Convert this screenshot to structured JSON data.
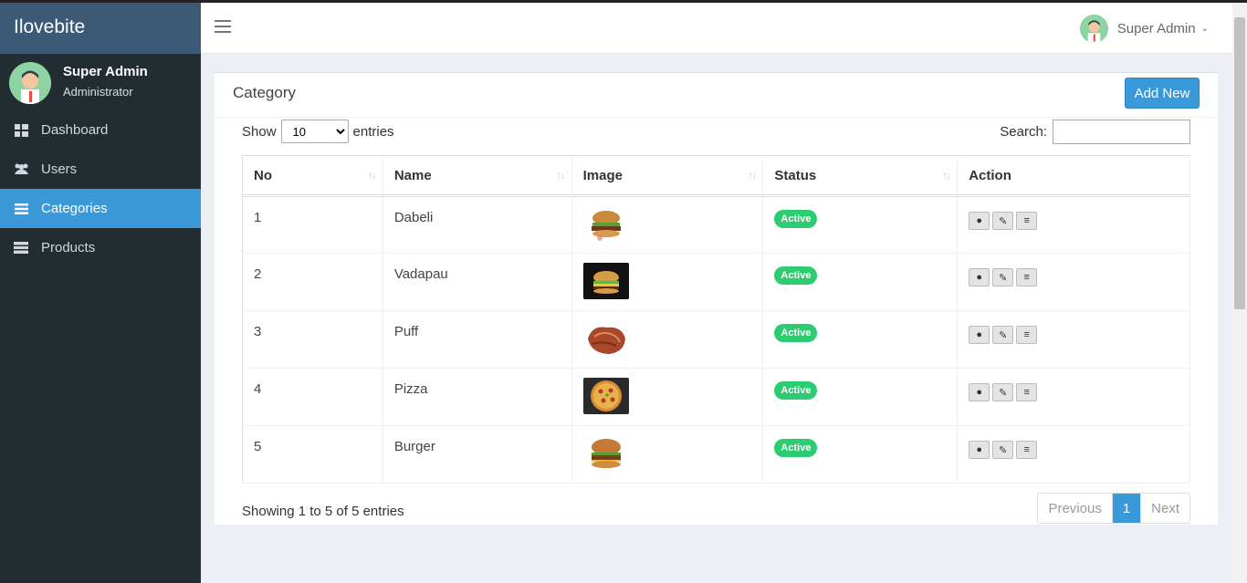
{
  "brand": "Ilovebite",
  "user": {
    "name": "Super Admin",
    "role": "Administrator"
  },
  "header_user": "Super Admin",
  "menu": [
    {
      "label": "Dashboard",
      "icon": "dashboard-icon"
    },
    {
      "label": "Users",
      "icon": "users-icon"
    },
    {
      "label": "Categories",
      "icon": "list-icon",
      "active": true
    },
    {
      "label": "Products",
      "icon": "products-icon"
    }
  ],
  "box": {
    "title": "Category",
    "add_label": "Add New"
  },
  "controls": {
    "show_label": "Show",
    "entries_label": "entries",
    "page_size": "10",
    "search_label": "Search:"
  },
  "table": {
    "headers": [
      "No",
      "Name",
      "Image",
      "Status",
      "Action"
    ],
    "rows": [
      {
        "no": "1",
        "name": "Dabeli",
        "status": "Active",
        "image": "burger-white-bg"
      },
      {
        "no": "2",
        "name": "Vadapau",
        "status": "Active",
        "image": "burger-dark-bg"
      },
      {
        "no": "3",
        "name": "Puff",
        "status": "Active",
        "image": "fried-food"
      },
      {
        "no": "4",
        "name": "Pizza",
        "status": "Active",
        "image": "pizza"
      },
      {
        "no": "5",
        "name": "Burger",
        "status": "Active",
        "image": "burger-white-bg"
      }
    ]
  },
  "footer": {
    "info": "Showing 1 to 5 of 5 entries",
    "prev": "Previous",
    "page": "1",
    "next": "Next"
  },
  "colors": {
    "sidebar": "#222d32",
    "accent": "#3a99d8",
    "active_badge": "#2ecc71"
  }
}
